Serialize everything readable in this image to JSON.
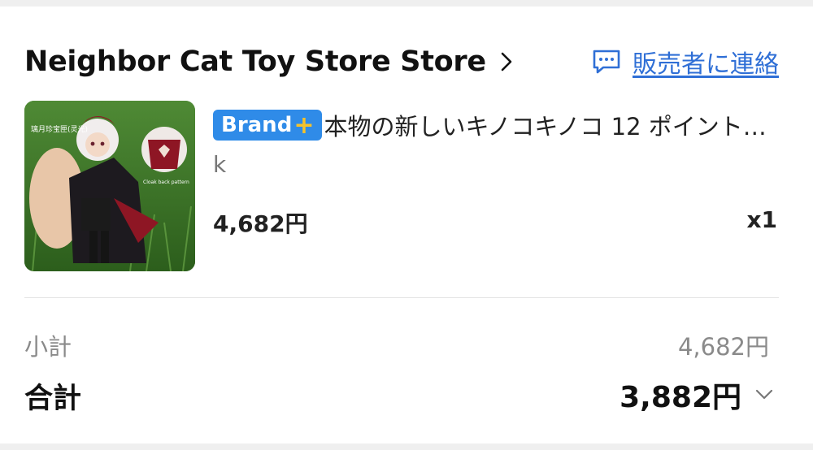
{
  "store": {
    "name": "Neighbor Cat Toy Store Store",
    "contact_label": "販売者に連絡"
  },
  "product": {
    "badge_text": "Brand",
    "badge_plus": "+",
    "title": "本物の新しいキノコキノコ 12 ポイント…",
    "variant": "k",
    "price": "4,682円",
    "quantity": "x1",
    "image_caption": "璃月珍宝匣(灵光)",
    "image_subcaption": "Cloak back pattern"
  },
  "summary": {
    "subtotal_label": "小計",
    "subtotal_value": "4,682円",
    "total_label": "合計",
    "total_value": "3,882円"
  },
  "colors": {
    "link": "#2f6fd6",
    "badge_bg": "#2f8be8",
    "badge_plus": "#f6c22b"
  },
  "icons": {
    "store_chevron": "chevron-right-icon",
    "contact": "chat-bubble-icon",
    "total_expand": "chevron-down-icon"
  }
}
